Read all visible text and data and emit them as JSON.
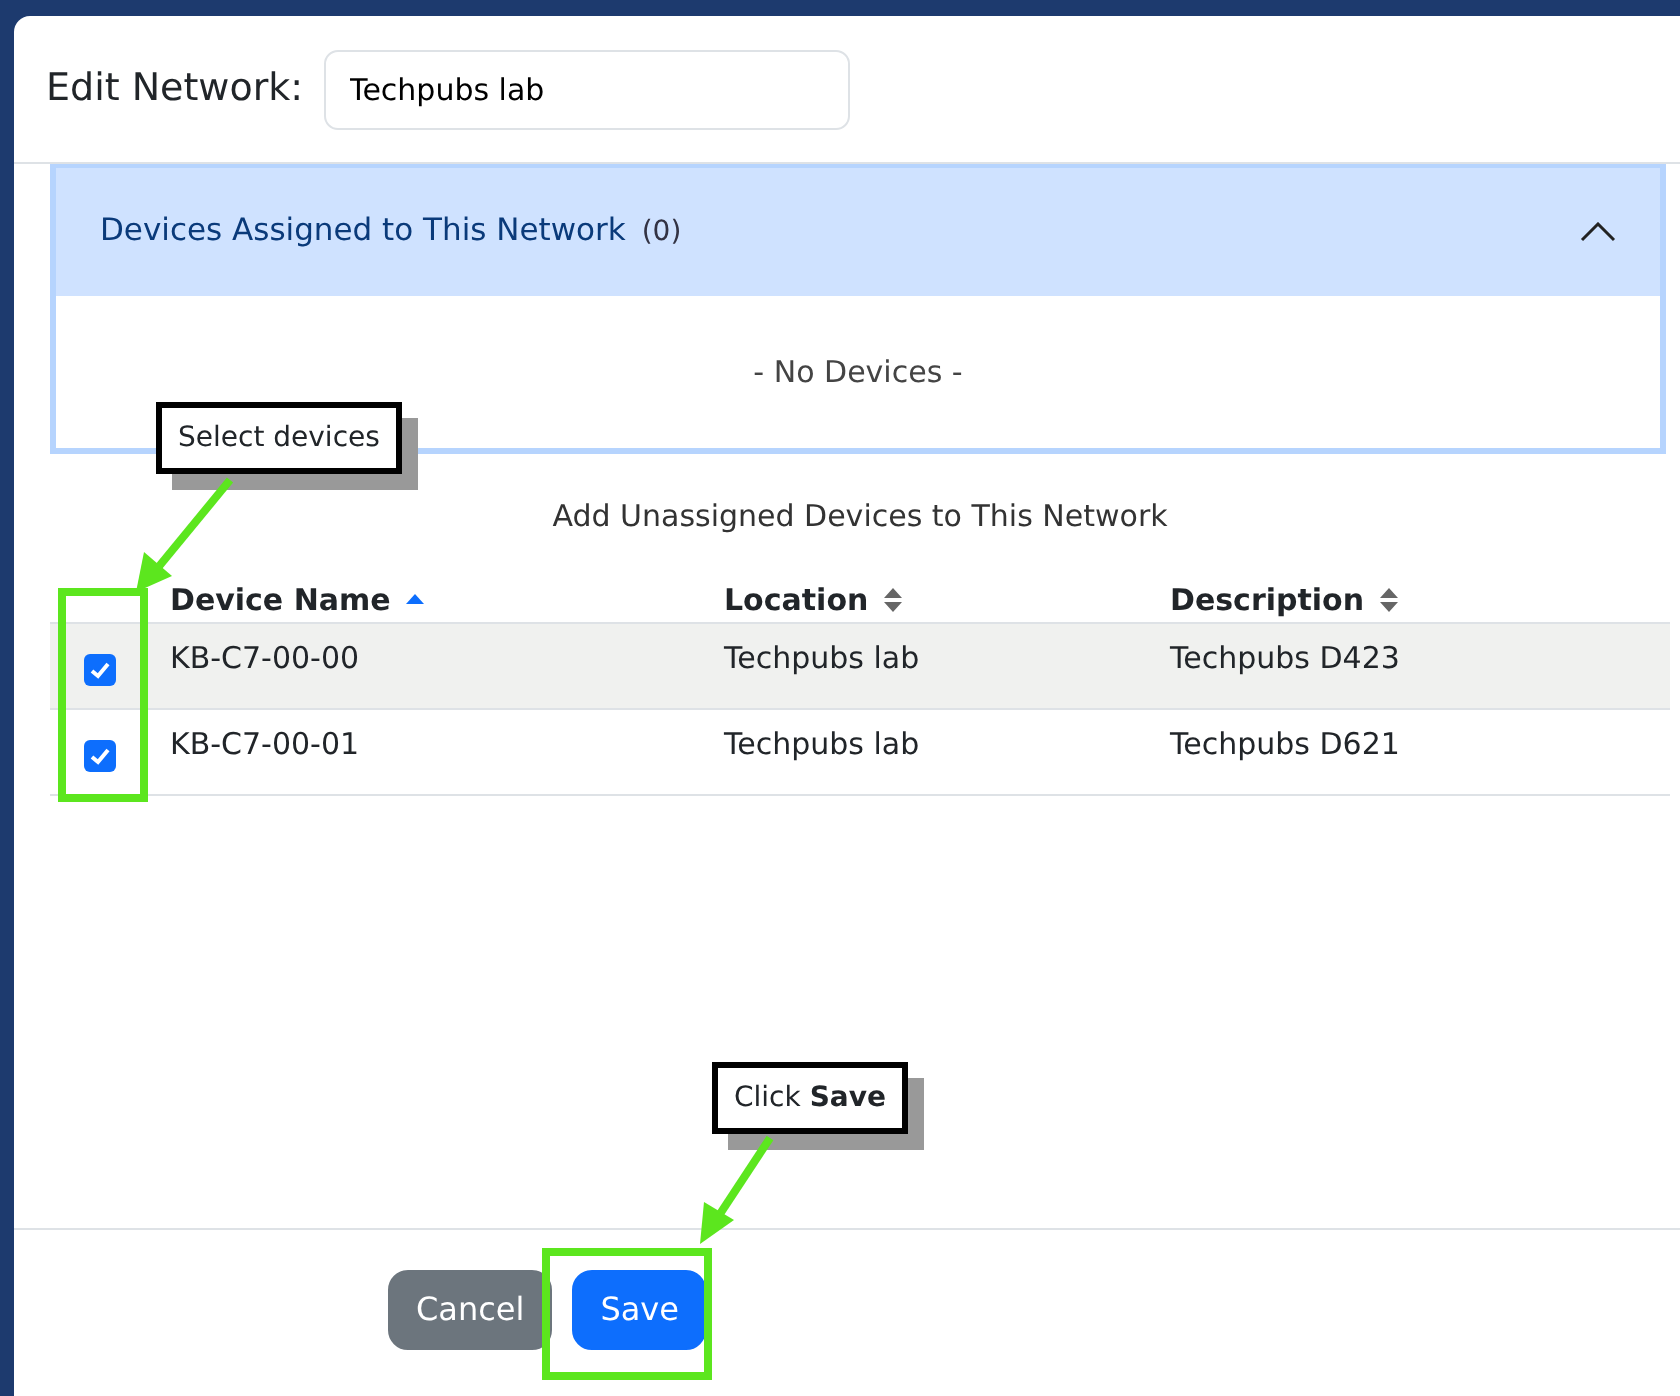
{
  "dialog": {
    "title_label": "Edit Network:",
    "network_name": "Techpubs lab"
  },
  "assigned_panel": {
    "title": "Devices Assigned to This Network",
    "count": "(0)",
    "expanded": true,
    "empty_text": "- No Devices -"
  },
  "unassigned": {
    "heading": "Add Unassigned Devices to This Network",
    "columns": [
      {
        "label": "Device Name",
        "sorted": true
      },
      {
        "label": "Location",
        "sorted": false
      },
      {
        "label": "Description",
        "sorted": false
      }
    ],
    "rows": [
      {
        "checked": true,
        "highlighted": true,
        "cells": [
          "KB-C7-00-00",
          "Techpubs lab",
          "Techpubs D423"
        ]
      },
      {
        "checked": true,
        "highlighted": false,
        "cells": [
          "KB-C7-00-01",
          "Techpubs lab",
          "Techpubs D621"
        ]
      }
    ]
  },
  "buttons": [
    {
      "label": "Cancel",
      "kind": "secondary"
    },
    {
      "label": "Save",
      "kind": "primary"
    }
  ],
  "callouts": [
    {
      "text": "Select devices"
    },
    {
      "text": "Click **Save**"
    }
  ]
}
